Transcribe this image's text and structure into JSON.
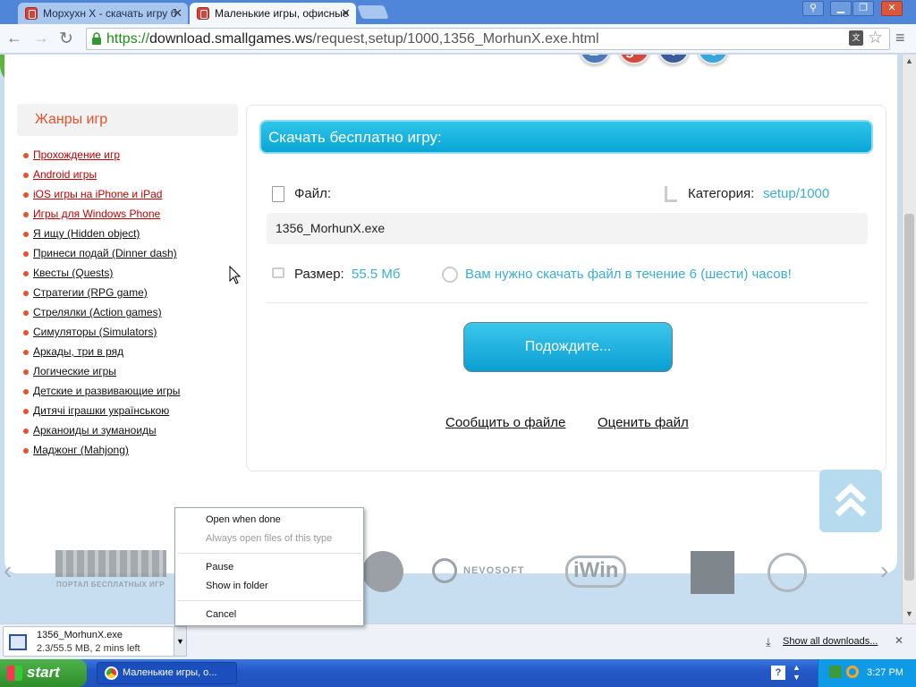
{
  "browser": {
    "tabs": [
      {
        "title": "Морхухн Х - скачать игру б",
        "active": false
      },
      {
        "title": "Маленькие игры, офисные",
        "active": true
      }
    ],
    "url": {
      "scheme": "https://",
      "host": "download.smallgames.ws",
      "path": "/request,setup/1000,1356_MorhunX.exe.html"
    }
  },
  "sidebar": {
    "title": "Жанры игр",
    "genres": [
      {
        "label": "Прохождение игр",
        "highlight": true
      },
      {
        "label": "Android игры",
        "highlight": true
      },
      {
        "label": "iOS игры на iPhone и iPad",
        "highlight": true
      },
      {
        "label": "Игры для Windows Phone",
        "highlight": true
      },
      {
        "label": "Я ищу (Hidden object)",
        "highlight": false
      },
      {
        "label": "Принеси подай (Dinner dash)",
        "highlight": false
      },
      {
        "label": "Квесты (Quests)",
        "highlight": false
      },
      {
        "label": "Стратегии (RPG game)",
        "highlight": false
      },
      {
        "label": "Стрелялки (Action games)",
        "highlight": false
      },
      {
        "label": "Симуляторы (Simulators)",
        "highlight": false
      },
      {
        "label": "Аркады, три в ряд",
        "highlight": false
      },
      {
        "label": "Логические игры",
        "highlight": false
      },
      {
        "label": "Детские и развивающие игры",
        "highlight": false
      },
      {
        "label": "Дитячі іграшки українською",
        "highlight": false
      },
      {
        "label": "Арканоиды и зуманоиды",
        "highlight": false
      },
      {
        "label": "Маджонг (Mahjong)",
        "highlight": false
      }
    ]
  },
  "download_box": {
    "title": "Скачать бесплатно игру:",
    "file_label": "Файл:",
    "category_label": "Категория:",
    "category_value": "setup/1000",
    "filename": "1356_MorhunX.exe",
    "size_label": "Размер:",
    "size_value": "55.5 Мб",
    "time_notice": "Вам нужно скачать файл в течение 6 (шести) часов!",
    "wait_button": "Подождите...",
    "report_link": "Сообщить о файле",
    "rate_link": "Оценить файл"
  },
  "social": [
    "В",
    "g+",
    "f",
    "t"
  ],
  "partners": [
    "ПОРТАЛ БЕСПЛАТНЫХ ИГР",
    "NEVOSOFT",
    "iWin"
  ],
  "context_menu": {
    "items": [
      {
        "label": "Open when done",
        "disabled": false
      },
      {
        "label": "Always open files of this type",
        "disabled": true
      },
      {
        "label": "Pause",
        "disabled": false
      },
      {
        "label": "Show in folder",
        "disabled": false
      },
      {
        "label": "Cancel",
        "disabled": false
      }
    ]
  },
  "download_shelf": {
    "filename": "1356_MorhunX.exe",
    "progress_text": "2.3/55.5 MB, 2 mins left",
    "progress_fraction": 0.041,
    "show_all": "Show all downloads..."
  },
  "taskbar": {
    "start_label": "start",
    "task_title": "Маленькие игры, о...",
    "clock": "3:27 PM"
  }
}
